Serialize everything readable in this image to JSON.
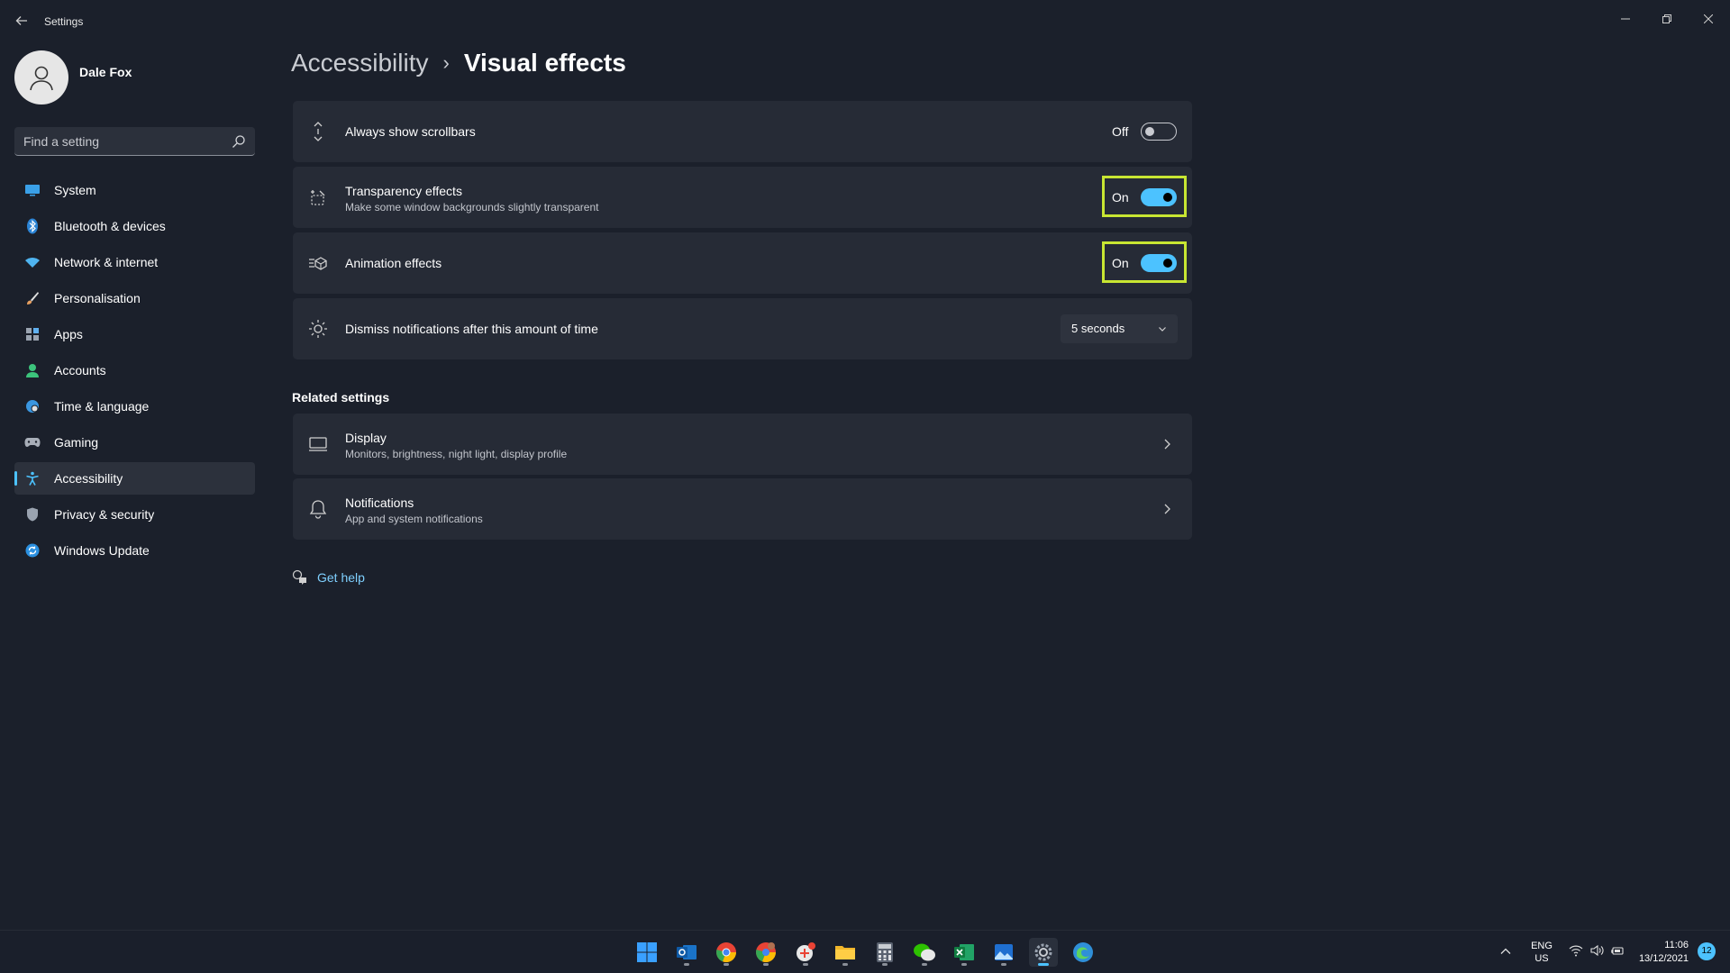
{
  "window": {
    "app_title": "Settings",
    "controls": {
      "minimize_icon": "minimize-icon",
      "maximize_icon": "restore-icon",
      "close_icon": "close-icon"
    }
  },
  "profile": {
    "name": "Dale Fox",
    "avatar_icon": "person-icon"
  },
  "search": {
    "placeholder": "Find a setting",
    "value": ""
  },
  "sidebar": {
    "items": [
      {
        "label": "System",
        "icon": "monitor-icon",
        "active": false
      },
      {
        "label": "Bluetooth & devices",
        "icon": "bluetooth-icon",
        "active": false
      },
      {
        "label": "Network & internet",
        "icon": "wifi-icon",
        "active": false
      },
      {
        "label": "Personalisation",
        "icon": "brush-icon",
        "active": false
      },
      {
        "label": "Apps",
        "icon": "apps-icon",
        "active": false
      },
      {
        "label": "Accounts",
        "icon": "account-icon",
        "active": false
      },
      {
        "label": "Time & language",
        "icon": "globe-clock-icon",
        "active": false
      },
      {
        "label": "Gaming",
        "icon": "gamepad-icon",
        "active": false
      },
      {
        "label": "Accessibility",
        "icon": "accessibility-icon",
        "active": true
      },
      {
        "label": "Privacy & security",
        "icon": "shield-icon",
        "active": false
      },
      {
        "label": "Windows Update",
        "icon": "update-icon",
        "active": false
      }
    ]
  },
  "breadcrumb": {
    "parent": "Accessibility",
    "separator": "›",
    "current": "Visual effects"
  },
  "settings": {
    "scrollbars": {
      "title": "Always show scrollbars",
      "state_label": "Off",
      "on": false
    },
    "transparency": {
      "title": "Transparency effects",
      "subtitle": "Make some window backgrounds slightly transparent",
      "state_label": "On",
      "on": true
    },
    "animation": {
      "title": "Animation effects",
      "state_label": "On",
      "on": true
    },
    "dismiss": {
      "title": "Dismiss notifications after this amount of time",
      "selected": "5 seconds"
    }
  },
  "related": {
    "title": "Related settings",
    "items": [
      {
        "title": "Display",
        "subtitle": "Monitors, brightness, night light, display profile"
      },
      {
        "title": "Notifications",
        "subtitle": "App and system notifications"
      }
    ]
  },
  "help": {
    "label": "Get help"
  },
  "taskbar": {
    "apps": [
      "start-icon",
      "outlook-icon",
      "chrome-icon",
      "chrome-profile-icon",
      "app-with-badge-icon",
      "file-explorer-icon",
      "calculator-icon",
      "wechat-icon",
      "excel-icon",
      "photos-icon",
      "settings-icon",
      "edge-icon"
    ],
    "lang_top": "ENG",
    "lang_bottom": "US",
    "time": "11:06",
    "date": "13/12/2021",
    "notifications": "12"
  },
  "colors": {
    "accent": "#4cc2ff",
    "highlight": "#c8e632",
    "background": "#1b202b",
    "card": "#262b36"
  }
}
